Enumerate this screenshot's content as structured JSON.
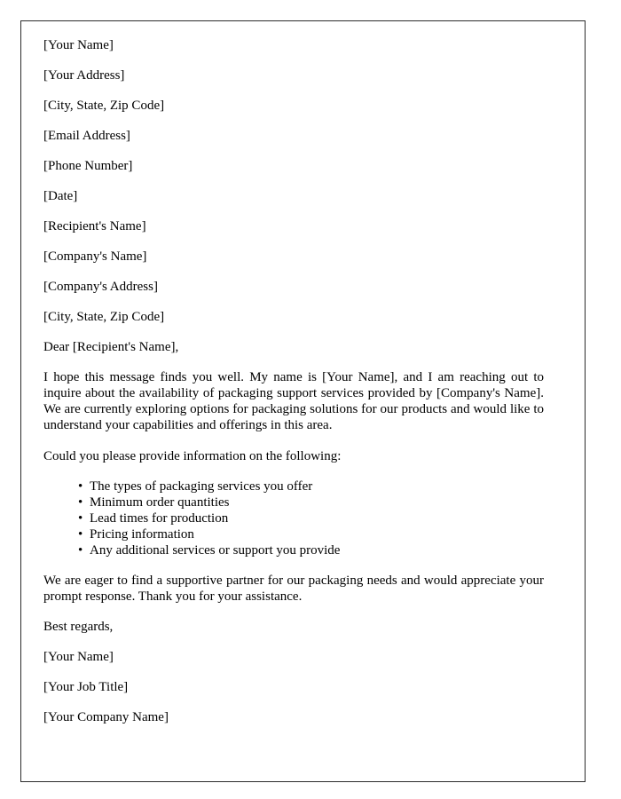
{
  "document": {
    "sender": [
      "[Your Name]",
      "[Your Address]",
      "[City, State, Zip Code]",
      "[Email Address]",
      "[Phone Number]",
      "[Date]"
    ],
    "recipient": [
      "[Recipient's Name]",
      "[Company's Name]",
      "[Company's Address]",
      "[City, State, Zip Code]"
    ],
    "salutation": "Dear [Recipient's Name],",
    "body": {
      "opening_paragraph": "I hope this message finds you well. My name is [Your Name], and I am reaching out to inquire about the availability of packaging support services provided by [Company's Name]. We are currently exploring options for packaging solutions for our products and would like to understand your capabilities and offerings in this area.",
      "request_intro": "Could you please provide information on the following:",
      "request_items": [
        "The types of packaging services you offer",
        "Minimum order quantities",
        "Lead times for production",
        "Pricing information",
        "Any additional services or support you provide"
      ],
      "closing_paragraph": "We are eager to find a supportive partner for our packaging needs and would appreciate your prompt response. Thank you for your assistance."
    },
    "sign_off": "Best regards,",
    "signature": [
      "[Your Name]",
      "[Your Job Title]",
      "[Your Company Name]"
    ]
  }
}
